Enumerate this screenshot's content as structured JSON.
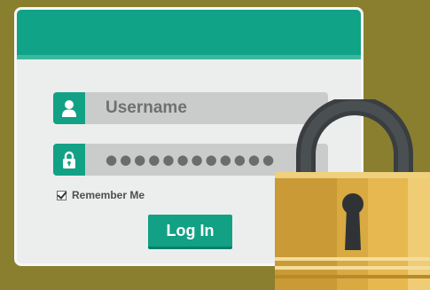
{
  "login": {
    "username_placeholder": "Username",
    "password_masked": "●●●●●●●●●●●●",
    "remember_label": "Remember Me",
    "remember_checked": true,
    "button_label": "Log In"
  },
  "icons": {
    "username": "user-icon",
    "password": "lock-icon",
    "illustration": "padlock-icon"
  },
  "colors": {
    "background": "#8a7f2f",
    "accent": "#10a387",
    "window": "#eceeed",
    "padlock_body": "#e2b44a",
    "padlock_shackle": "#404447"
  }
}
